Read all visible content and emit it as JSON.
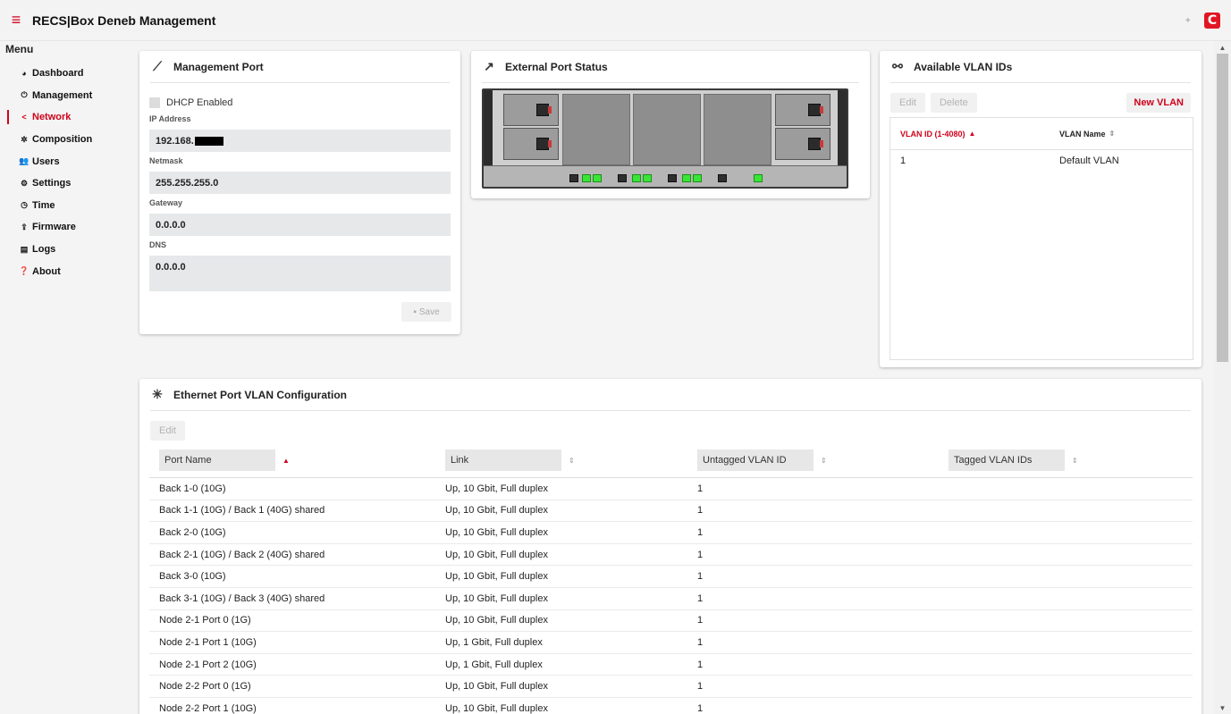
{
  "header": {
    "title": "RECS|Box Deneb Management",
    "menu_icon": "hamburger-icon",
    "logo_letter": "C",
    "accent_color": "#d0021b"
  },
  "sidebar": {
    "title": "Menu",
    "items": [
      {
        "label": "Dashboard",
        "icon": "gauge-icon",
        "glyph": "◕"
      },
      {
        "label": "Management",
        "icon": "power-icon",
        "glyph": "⏻"
      },
      {
        "label": "Network",
        "icon": "share-icon",
        "glyph": "<",
        "active": true
      },
      {
        "label": "Composition",
        "icon": "composition-icon",
        "glyph": "✲"
      },
      {
        "label": "Users",
        "icon": "users-icon",
        "glyph": "👥"
      },
      {
        "label": "Settings",
        "icon": "gears-icon",
        "glyph": "⚙"
      },
      {
        "label": "Time",
        "icon": "clock-icon",
        "glyph": "◷"
      },
      {
        "label": "Firmware",
        "icon": "upload-icon",
        "glyph": "⇪"
      },
      {
        "label": "Logs",
        "icon": "file-icon",
        "glyph": "▤"
      },
      {
        "label": "About",
        "icon": "question-icon",
        "glyph": "❓"
      }
    ]
  },
  "management_port": {
    "title": "Management Port",
    "dhcp_label": "DHCP Enabled",
    "ip_label": "IP Address",
    "ip_value": "192.168.",
    "netmask_label": "Netmask",
    "netmask_value": "255.255.255.0",
    "gateway_label": "Gateway",
    "gateway_value": "0.0.0.0",
    "dns_label": "DNS",
    "dns_value": "0.0.0.0",
    "save_label": "Save"
  },
  "external_port_status": {
    "title": "External Port Status"
  },
  "vlan_ids": {
    "title": "Available VLAN IDs",
    "edit_label": "Edit",
    "delete_label": "Delete",
    "new_label": "New VLAN",
    "columns": [
      "VLAN ID (1-4080)",
      "VLAN Name"
    ],
    "rows": [
      {
        "id": "1",
        "name": "Default VLAN"
      }
    ]
  },
  "ethernet_vlan": {
    "title": "Ethernet Port VLAN Configuration",
    "edit_label": "Edit",
    "columns": [
      "Port Name",
      "Link",
      "Untagged VLAN ID",
      "Tagged VLAN IDs"
    ],
    "rows": [
      {
        "port": "Back 1-0 (10G)",
        "link": "Up, 10 Gbit, Full duplex",
        "untagged": "1",
        "tagged": ""
      },
      {
        "port": "Back 1-1 (10G) / Back 1 (40G) shared",
        "link": "Up, 10 Gbit, Full duplex",
        "untagged": "1",
        "tagged": ""
      },
      {
        "port": "Back 2-0 (10G)",
        "link": "Up, 10 Gbit, Full duplex",
        "untagged": "1",
        "tagged": ""
      },
      {
        "port": "Back 2-1 (10G) / Back 2 (40G) shared",
        "link": "Up, 10 Gbit, Full duplex",
        "untagged": "1",
        "tagged": ""
      },
      {
        "port": "Back 3-0 (10G)",
        "link": "Up, 10 Gbit, Full duplex",
        "untagged": "1",
        "tagged": ""
      },
      {
        "port": "Back 3-1 (10G) / Back 3 (40G) shared",
        "link": "Up, 10 Gbit, Full duplex",
        "untagged": "1",
        "tagged": ""
      },
      {
        "port": "Node 2-1 Port 0 (1G)",
        "link": "Up, 10 Gbit, Full duplex",
        "untagged": "1",
        "tagged": ""
      },
      {
        "port": "Node 2-1 Port 1 (10G)",
        "link": "Up, 1 Gbit, Full duplex",
        "untagged": "1",
        "tagged": ""
      },
      {
        "port": "Node 2-1 Port 2 (10G)",
        "link": "Up, 1 Gbit, Full duplex",
        "untagged": "1",
        "tagged": ""
      },
      {
        "port": "Node 2-2 Port 0 (1G)",
        "link": "Up, 10 Gbit, Full duplex",
        "untagged": "1",
        "tagged": ""
      },
      {
        "port": "Node 2-2 Port 1 (10G)",
        "link": "Up, 10 Gbit, Full duplex",
        "untagged": "1",
        "tagged": ""
      }
    ]
  }
}
